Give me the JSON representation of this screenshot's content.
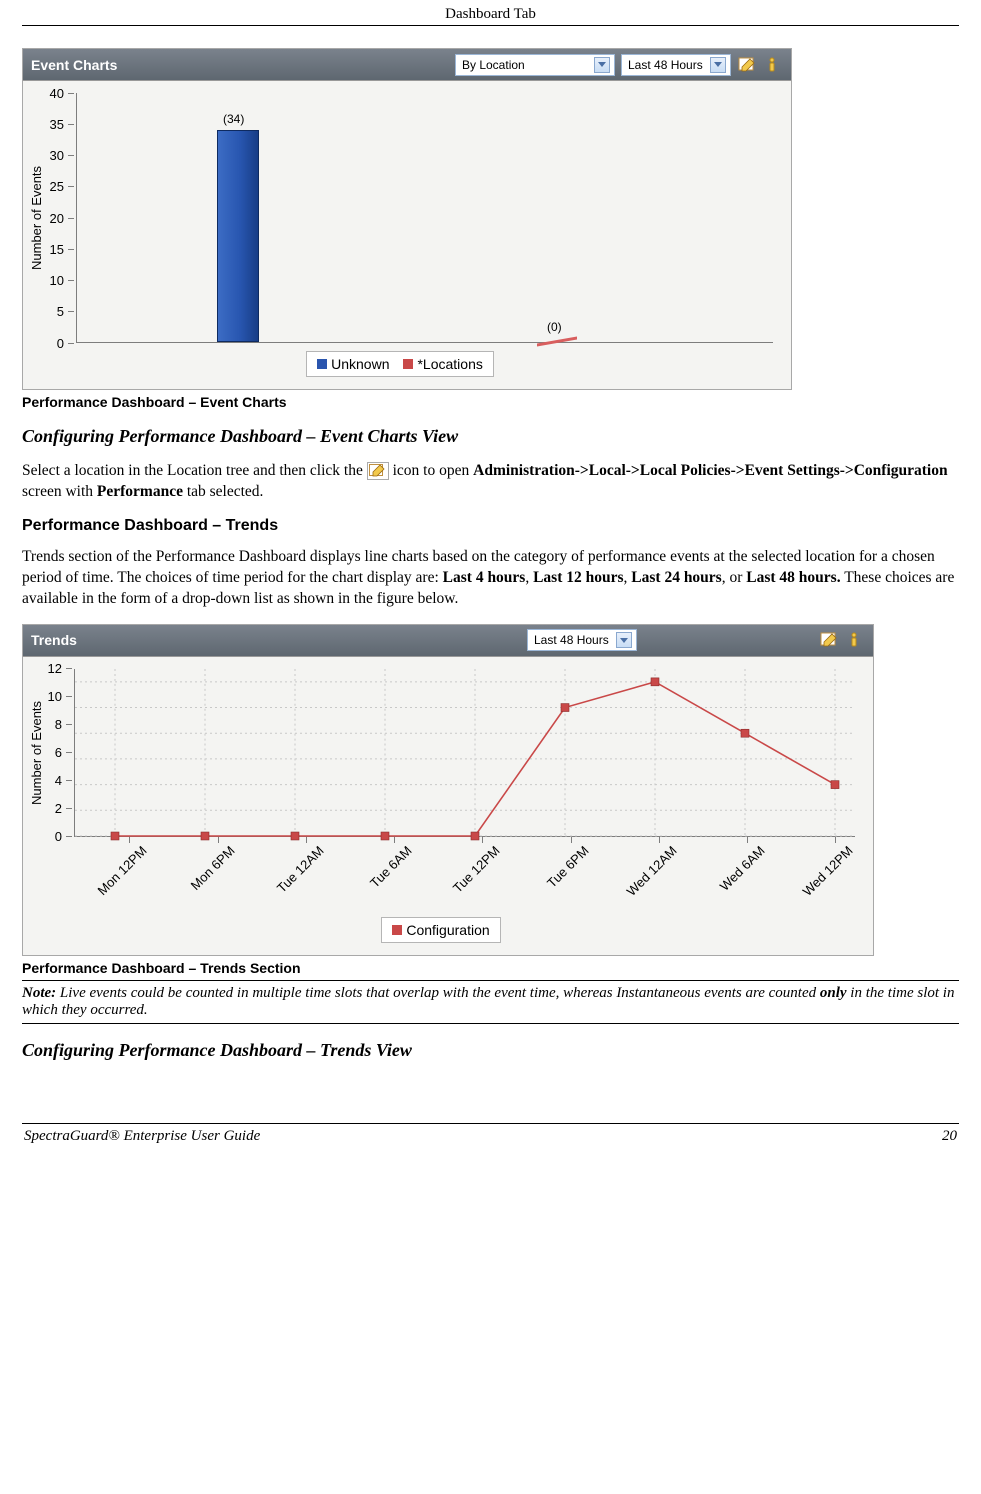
{
  "header": {
    "title": "Dashboard Tab"
  },
  "event_panel": {
    "title": "Event Charts",
    "select_view": "By Location",
    "select_period": "Last 48 Hours",
    "ylabel": "Number of Events"
  },
  "event_legend": {
    "a": "Unknown",
    "b": "*Locations"
  },
  "chart_data": [
    {
      "type": "bar",
      "title": "Event Charts",
      "ylabel": "Number of Events",
      "yticks": [
        0,
        5,
        10,
        15,
        20,
        25,
        30,
        35,
        40
      ],
      "ylim": [
        0,
        42
      ],
      "series": [
        {
          "name": "Unknown",
          "color": "#2a55ae",
          "categories": [
            "Unknown"
          ],
          "values": [
            34
          ]
        },
        {
          "name": "*Locations",
          "color": "#c94848",
          "categories": [
            "*Locations"
          ],
          "values": [
            0
          ]
        }
      ],
      "data_labels": {
        "unknown": "(34)",
        "locations": "(0)"
      }
    },
    {
      "type": "line",
      "title": "Trends",
      "ylabel": "Number of Events",
      "yticks": [
        0,
        2,
        4,
        6,
        8,
        10,
        12
      ],
      "ylim": [
        0,
        13
      ],
      "categories": [
        "Mon 12PM",
        "Mon 6PM",
        "Tue 12AM",
        "Tue 6AM",
        "Tue 12PM",
        "Tue 6PM",
        "Wed 12AM",
        "Wed 6AM",
        "Wed 12PM"
      ],
      "series": [
        {
          "name": "Configuration",
          "color": "#c94848",
          "values": [
            0,
            0,
            0,
            0,
            0,
            10,
            12,
            8,
            4
          ]
        }
      ]
    }
  ],
  "caption1": "Performance Dashboard – Event Charts",
  "section1_h": "Configuring Performance Dashboard – Event Charts View",
  "section1_body": {
    "pre": "Select a location in the Location tree and then click the ",
    "post_icon_a": " icon to open ",
    "bold_a": "Administration->Local->Local Policies->Event Settings->Configuration",
    "mid": " screen with ",
    "bold_b": "Performance",
    "tail": " tab selected."
  },
  "section2_h": "Performance Dashboard – Trends",
  "section2_body": {
    "a": "Trends section of the Performance Dashboard displays line charts based on the category of performance events at the selected location for a chosen period of time. The choices of time period for the chart display are: ",
    "b1": "Last 4 hours",
    "c1": ", ",
    "b2": "Last 12 hours",
    "c2": ", ",
    "b3": "Last 24 hours",
    "c3": ", or ",
    "b4": "Last 48 hours.",
    "d": " These choices are available in the form of a drop-down list as shown in the figure below."
  },
  "trends_panel": {
    "title": "Trends",
    "select_period": "Last 48 Hours",
    "ylabel": "Number of Events"
  },
  "trends_legend": "Configuration",
  "caption2": "Performance Dashboard – Trends Section",
  "note": {
    "lead": "Note:",
    "body_a": " Live events could be counted in multiple time slots that overlap with the event time, whereas Instantaneous events are counted ",
    "only": "only",
    "body_b": " in the time slot in which they occurred."
  },
  "section3_h": "Configuring Performance Dashboard – Trends View",
  "footer": {
    "left": "SpectraGuard® Enterprise User Guide",
    "right": "20"
  }
}
